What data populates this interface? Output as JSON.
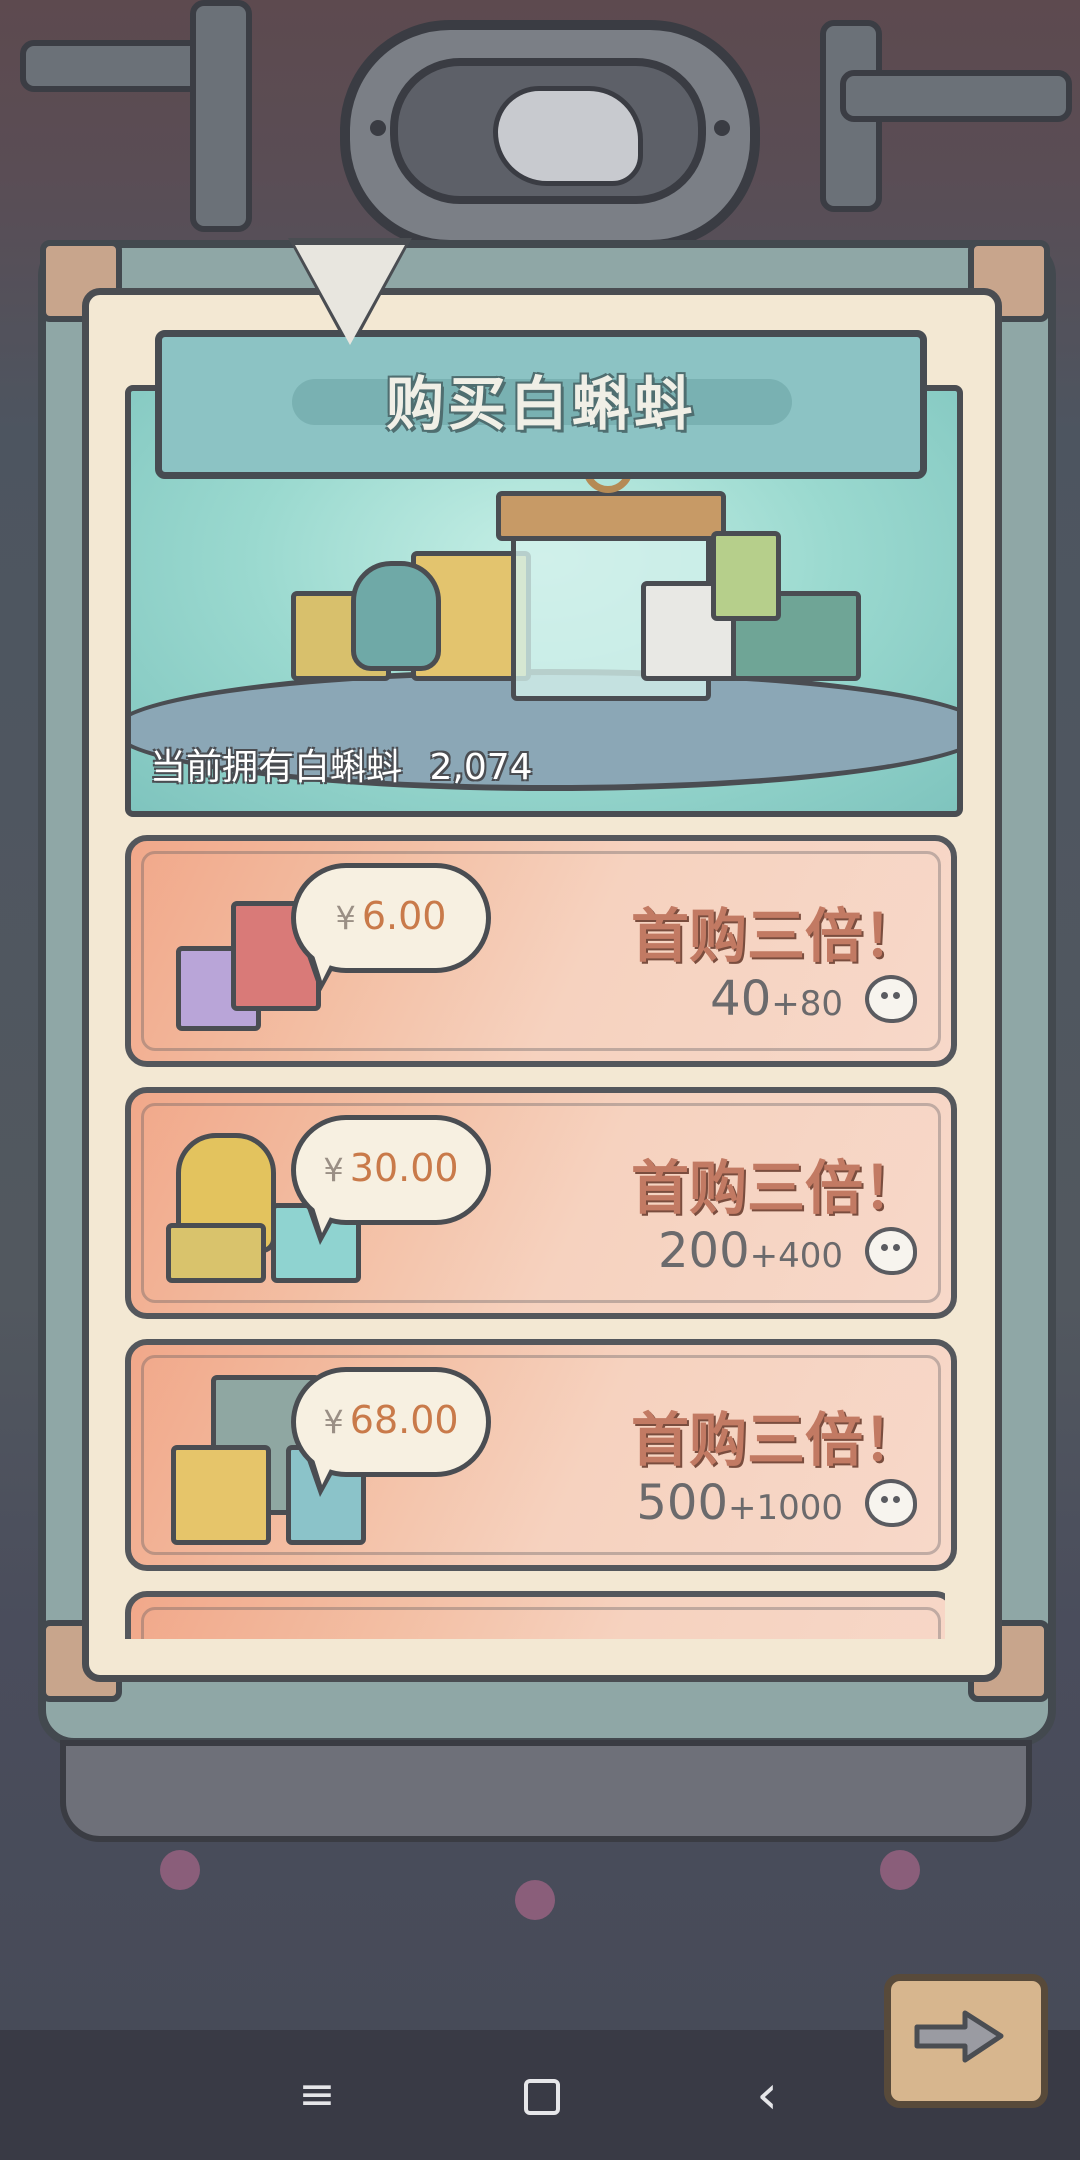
{
  "header": {
    "title": "购买白蝌蚪"
  },
  "balance": {
    "label": "当前拥有白蝌蚪",
    "value": "2,074"
  },
  "offers": [
    {
      "currency": "¥",
      "price": "6.00",
      "promo": "首购三倍！",
      "base": "40",
      "bonus": "+80",
      "icon": "tadpole-icon"
    },
    {
      "currency": "¥",
      "price": "30.00",
      "promo": "首购三倍！",
      "base": "200",
      "bonus": "+400",
      "icon": "tadpole-icon"
    },
    {
      "currency": "¥",
      "price": "68.00",
      "promo": "首购三倍！",
      "base": "500",
      "bonus": "+1000",
      "icon": "tadpole-icon"
    }
  ],
  "navbar": {
    "menu_icon": "≡",
    "home_icon": "□",
    "back_icon": "‹"
  },
  "next_button": {
    "icon": "arrow-right-icon"
  }
}
